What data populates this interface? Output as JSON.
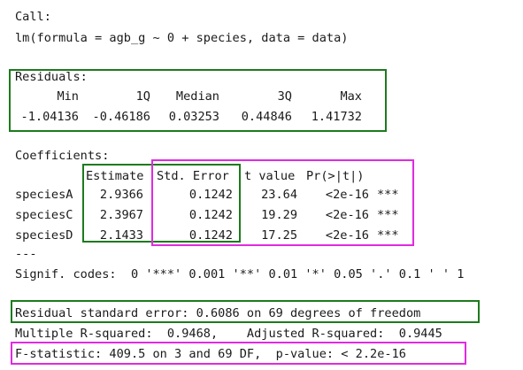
{
  "call": {
    "heading": "Call:",
    "formula": "lm(formula = agb_g ~ 0 + species, data = data)"
  },
  "residuals": {
    "heading": "Residuals:",
    "labels": [
      "Min",
      "1Q",
      "Median",
      "3Q",
      "Max"
    ],
    "values": [
      "-1.04136",
      "-0.46186",
      "0.03253",
      "0.44846",
      "1.41732"
    ]
  },
  "coefficients": {
    "heading": "Coefficients:",
    "columns": [
      "Estimate",
      "Std. Error",
      "t value",
      "Pr(>|t|)"
    ],
    "rows": [
      {
        "name": "speciesA",
        "estimate": "2.9366",
        "std_error": "0.1242",
        "t_value": "23.64",
        "p_value": "<2e-16",
        "stars": "***"
      },
      {
        "name": "speciesC",
        "estimate": "2.3967",
        "std_error": "0.1242",
        "t_value": "19.29",
        "p_value": "<2e-16",
        "stars": "***"
      },
      {
        "name": "speciesD",
        "estimate": "2.1433",
        "std_error": "0.1242",
        "t_value": "17.25",
        "p_value": "<2e-16",
        "stars": "***"
      }
    ],
    "separator": "---",
    "signif_codes": "Signif. codes:  0 '***' 0.001 '**' 0.01 '*' 0.05 '.' 0.1 ' ' 1"
  },
  "summary": {
    "residual_se": "Residual standard error: 0.6086 on 69 degrees of freedom",
    "r_squared": "Multiple R-squared:  0.9468,    Adjusted R-squared:  0.9445",
    "f_statistic": "F-statistic: 409.5 on 3 and 69 DF,  p-value: < 2.2e-16"
  },
  "highlight_colors": {
    "green": "#1e7a1e",
    "pink": "#e02be0"
  }
}
